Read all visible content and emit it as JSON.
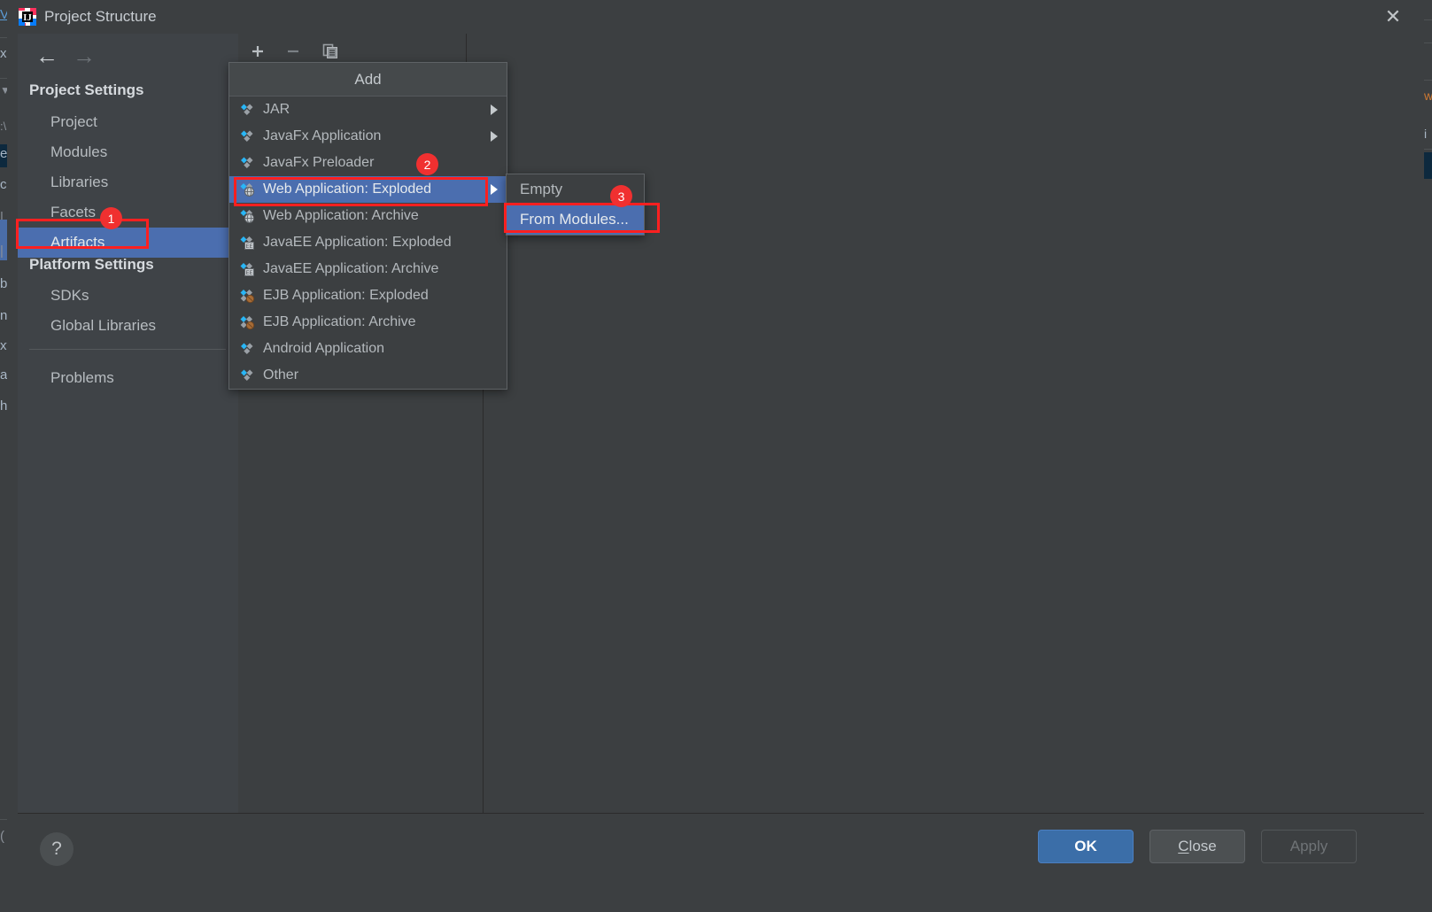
{
  "window": {
    "title": "Project Structure",
    "app_icon": "intellij-idea-icon",
    "close_icon": "close-icon"
  },
  "background": {
    "left_fragments": [
      "V",
      "x|",
      "C:\\",
      "e",
      "c",
      "|",
      "|",
      "b",
      "n",
      "xt",
      "a",
      "h"
    ],
    "right_fragments": [
      "w",
      "i"
    ]
  },
  "sidebar": {
    "back_icon": "arrow-left-icon",
    "forward_icon": "arrow-right-icon",
    "sections": [
      {
        "header": "Project Settings",
        "items": [
          {
            "label": "Project",
            "selected": false
          },
          {
            "label": "Modules",
            "selected": false
          },
          {
            "label": "Libraries",
            "selected": false
          },
          {
            "label": "Facets",
            "selected": false
          },
          {
            "label": "Artifacts",
            "selected": true
          }
        ]
      },
      {
        "header": "Platform Settings",
        "items": [
          {
            "label": "SDKs",
            "selected": false
          },
          {
            "label": "Global Libraries",
            "selected": false
          }
        ]
      }
    ],
    "extra_items": [
      {
        "label": "Problems",
        "selected": false
      }
    ]
  },
  "toolbar": {
    "buttons": [
      {
        "name": "add-button",
        "icon": "plus-icon",
        "enabled": true
      },
      {
        "name": "remove-button",
        "icon": "minus-icon",
        "enabled": false
      },
      {
        "name": "copy-button",
        "icon": "copy-icon",
        "enabled": true
      }
    ]
  },
  "add_menu": {
    "title": "Add",
    "items": [
      {
        "label": "JAR",
        "icon": "artifact-icon",
        "submenu": true,
        "selected": false
      },
      {
        "label": "JavaFx Application",
        "icon": "artifact-icon",
        "submenu": true,
        "selected": false
      },
      {
        "label": "JavaFx Preloader",
        "icon": "artifact-icon",
        "submenu": false,
        "selected": false
      },
      {
        "label": "Web Application: Exploded",
        "icon": "web-artifact-icon",
        "submenu": true,
        "selected": true
      },
      {
        "label": "Web Application: Archive",
        "icon": "web-artifact-icon",
        "submenu": false,
        "selected": false
      },
      {
        "label": "JavaEE Application: Exploded",
        "icon": "javaee-artifact-icon",
        "submenu": false,
        "selected": false
      },
      {
        "label": "JavaEE Application: Archive",
        "icon": "javaee-artifact-icon",
        "submenu": false,
        "selected": false
      },
      {
        "label": "EJB Application: Exploded",
        "icon": "ejb-artifact-icon",
        "submenu": false,
        "selected": false
      },
      {
        "label": "EJB Application: Archive",
        "icon": "ejb-artifact-icon",
        "submenu": false,
        "selected": false
      },
      {
        "label": "Android Application",
        "icon": "artifact-icon",
        "submenu": false,
        "selected": false
      },
      {
        "label": "Other",
        "icon": "artifact-icon",
        "submenu": false,
        "selected": false
      }
    ]
  },
  "web_submenu": {
    "items": [
      {
        "label": "Empty",
        "selected": false
      },
      {
        "label": "From Modules...",
        "selected": true
      }
    ]
  },
  "annotations": {
    "badges": [
      {
        "text": "1",
        "target": "artifacts-nav-item"
      },
      {
        "text": "2",
        "target": "web-application-exploded-menu-item"
      },
      {
        "text": "3",
        "target": "from-modules-submenu-item"
      }
    ],
    "box_color": "#ff2020",
    "badge_color": "#f03030"
  },
  "footer": {
    "help_icon": "help-icon",
    "buttons": [
      {
        "label": "OK",
        "state": "primary"
      },
      {
        "label": "Close",
        "state": "default",
        "mnemonic": "C"
      },
      {
        "label": "Apply",
        "state": "disabled"
      }
    ]
  },
  "colors": {
    "dialog_bg": "#3c3f41",
    "sidebar_bg": "#3f4347",
    "selection_blue": "#4b6eaf",
    "primary_button": "#3b6ea8",
    "text": "#b4b9bd",
    "accent_cyan": "#29b6f6"
  }
}
